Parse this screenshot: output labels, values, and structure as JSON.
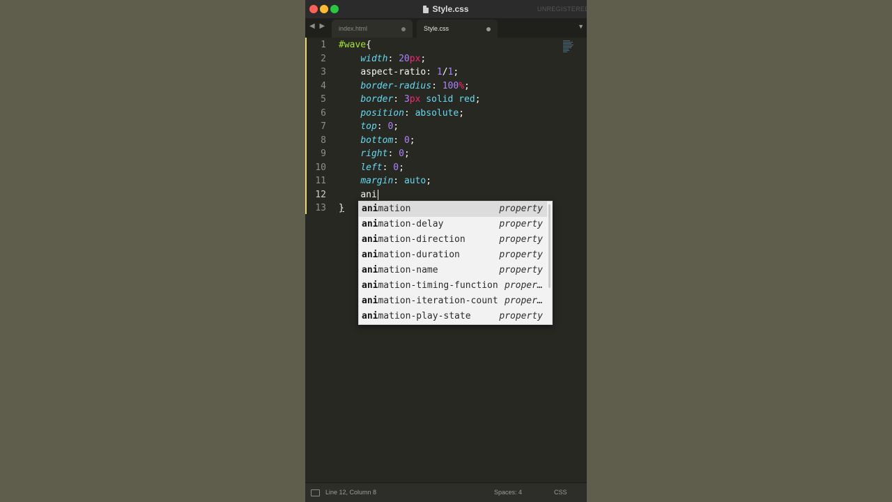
{
  "window": {
    "title": "Style.css",
    "unregistered": "UNREGISTERED"
  },
  "tabs": [
    {
      "label": "index.html",
      "active": false
    },
    {
      "label": "Style.css",
      "active": true
    }
  ],
  "editor": {
    "line_numbers": [
      "1",
      "2",
      "3",
      "4",
      "5",
      "6",
      "7",
      "8",
      "9",
      "10",
      "11",
      "12",
      "13"
    ],
    "current_line": 12
  },
  "autocomplete": {
    "typed": "ani",
    "items": [
      {
        "rest": "mation",
        "hint": "property"
      },
      {
        "rest": "mation-delay",
        "hint": "property"
      },
      {
        "rest": "mation-direction",
        "hint": "property"
      },
      {
        "rest": "mation-duration",
        "hint": "property"
      },
      {
        "rest": "mation-name",
        "hint": "property"
      },
      {
        "rest": "mation-timing-function",
        "hint": "proper…"
      },
      {
        "rest": "mation-iteration-count",
        "hint": "proper…"
      },
      {
        "rest": "mation-play-state",
        "hint": "property"
      }
    ]
  },
  "statusbar": {
    "position": "Line 12, Column 8",
    "spaces": "Spaces: 4",
    "syntax": "CSS"
  },
  "colors": {
    "selector": "#a6e22e",
    "property": "#66d9ef",
    "number": "#ae81ff",
    "unit": "#f92672",
    "background": "#272822"
  }
}
